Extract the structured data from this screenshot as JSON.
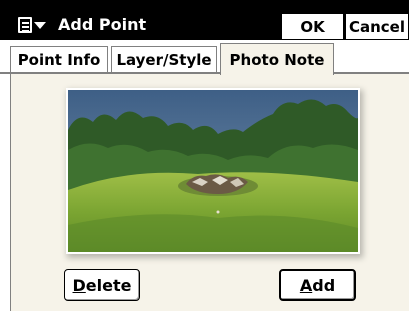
{
  "window": {
    "title": "Add Point",
    "ok_label": "OK",
    "cancel_label": "Cancel"
  },
  "tabs": [
    {
      "label": "Point Info",
      "active": false
    },
    {
      "label": "Layer/Style",
      "active": false
    },
    {
      "label": "Photo Note",
      "active": true
    }
  ],
  "photo_note": {
    "delete_button": {
      "mnemonic": "D",
      "rest": "elete"
    },
    "add_button": {
      "mnemonic": "A",
      "rest": "dd"
    }
  },
  "colors": {
    "titlebar": "#000000",
    "panel": "#f6f3e9",
    "tab_border": "#808080"
  }
}
